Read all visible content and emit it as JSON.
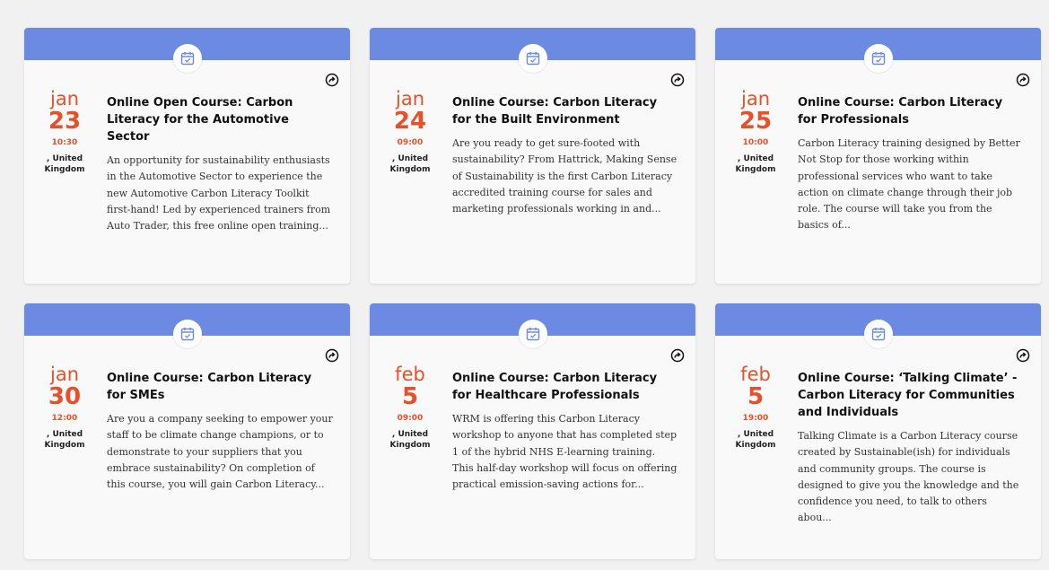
{
  "cards": [
    {
      "month": "jan",
      "day": "23",
      "time": "10:30",
      "location": ", United Kingdom",
      "title": "Online Open Course: Carbon Literacy for the Automotive Sector",
      "description": "An opportunity for sustainability enthusiasts in the Automotive Sector to experience the new Automotive Carbon Literacy Toolkit first-hand! Led by experienced trainers from Auto Trader, this free online open training..."
    },
    {
      "month": "jan",
      "day": "24",
      "time": "09:00",
      "location": ", United Kingdom",
      "title": "Online Course: Carbon Literacy for the Built Environment",
      "description": "Are you ready to get sure-footed with sustainability? From Hattrick, Making Sense of Sustainability is the first Carbon Literacy accredited training course for sales and marketing professionals working in and..."
    },
    {
      "month": "jan",
      "day": "25",
      "time": "10:00",
      "location": ", United Kingdom",
      "title": "Online Course: Carbon Literacy for Professionals",
      "description": "Carbon Literacy training designed by Better Not Stop for those working within professional services who want to take action on climate change through their job role. The course will take you from the basics of..."
    },
    {
      "month": "jan",
      "day": "30",
      "time": "12:00",
      "location": ", United Kingdom",
      "title": "Online Course: Carbon Literacy for SMEs",
      "description": "Are you a company seeking to empower your staff to be climate change champions, or to demonstrate to your suppliers that you embrace sustainability? On completion of this course, you will gain Carbon Literacy..."
    },
    {
      "month": "feb",
      "day": "5",
      "time": "09:00",
      "location": ", United Kingdom",
      "title": "Online Course: Carbon Literacy for Healthcare Professionals",
      "description": "WRM is offering this Carbon Literacy workshop to anyone that has completed step 1 of the hybrid NHS E-learning training. This half-day workshop will focus on offering practical emission-saving actions for..."
    },
    {
      "month": "feb",
      "day": "5",
      "time": "19:00",
      "location": ", United Kingdom",
      "title": "Online Course: ‘Talking Climate’ - Carbon Literacy for Communities and Individuals",
      "description": "Talking Climate is a Carbon Literacy course created by Sustainable(ish) for individuals and community groups. The course is designed to give you the knowledge and the confidence you need, to talk to others abou..."
    }
  ],
  "icons": {
    "header": "calendar-icon",
    "action": "share-icon"
  },
  "colors": {
    "header": "#6d8ae3",
    "date_accent": "#e8502a",
    "background": "#f1f1f1",
    "card": "#f9f9f9"
  }
}
